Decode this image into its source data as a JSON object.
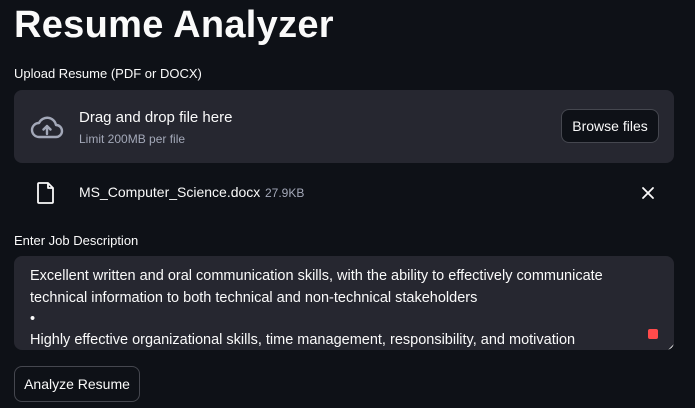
{
  "app": {
    "title": "Resume Analyzer"
  },
  "upload": {
    "label": "Upload Resume (PDF or DOCX)",
    "dropzone_title": "Drag and drop file here",
    "dropzone_limit": "Limit 200MB per file",
    "browse_label": "Browse files",
    "file": {
      "name": "MS_Computer_Science.docx",
      "size": "27.9KB"
    }
  },
  "job_description": {
    "label": "Enter Job Description",
    "lines": [
      "•",
      "Excellent written and oral communication skills, with the ability to effectively communicate",
      "technical information to both technical and non-technical stakeholders",
      "•",
      "Highly effective organizational skills, time management, responsibility, and motivation"
    ]
  },
  "actions": {
    "analyze_label": "Analyze Resume"
  },
  "colors": {
    "background": "#0e1117",
    "panel": "#262730",
    "text": "#fafafa",
    "muted": "#a3a8b8",
    "accent": "#ff4b4b"
  },
  "icons": {
    "upload": "cloud-upload-icon",
    "file": "file-icon",
    "remove": "close-icon"
  }
}
